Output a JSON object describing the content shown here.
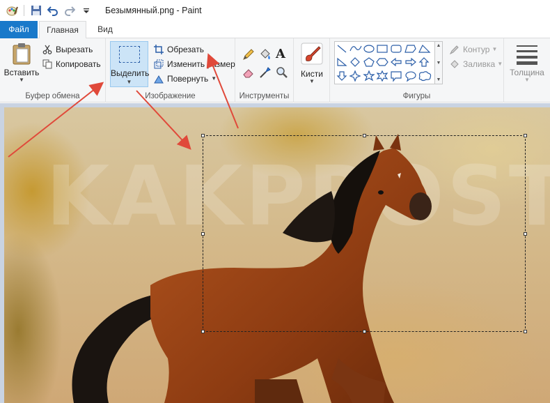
{
  "window": {
    "title": "Безымянный.png - Paint"
  },
  "tabs": {
    "file": "Файл",
    "home": "Главная",
    "view": "Вид"
  },
  "clipboard": {
    "group_label": "Буфер обмена",
    "paste": "Вставить",
    "cut": "Вырезать",
    "copy": "Копировать"
  },
  "image_group": {
    "group_label": "Изображение",
    "select": "Выделить",
    "crop": "Обрезать",
    "resize": "Изменить размер",
    "rotate": "Повернуть"
  },
  "tools": {
    "group_label": "Инструменты"
  },
  "brushes": {
    "label": "Кисти"
  },
  "shapes": {
    "group_label": "Фигуры",
    "outline": "Контур",
    "fill": "Заливка"
  },
  "size": {
    "label": "Толщина"
  },
  "canvas": {
    "watermark": "KAKPROSTO.RU"
  },
  "colors": {
    "file_tab": "#1979ca",
    "selected_button": "#cce4f7",
    "arrow": "#e0493a"
  }
}
